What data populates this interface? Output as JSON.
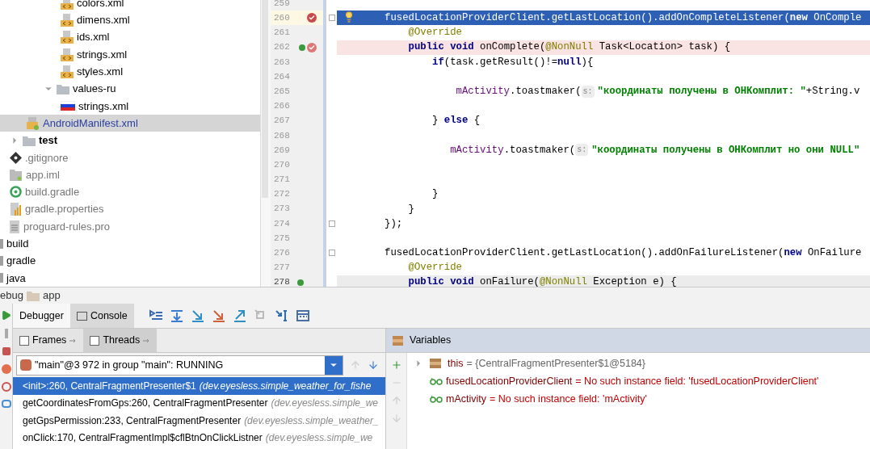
{
  "project_tree": [
    {
      "children": [
        {
          "children": [
            {
              "children": [
                {
                  "children": [
                    {
                      "label": "colors.xml",
                      "kind": "xml"
                    },
                    {
                      "label": "dimens.xml",
                      "kind": "xml"
                    },
                    {
                      "label": "ids.xml",
                      "kind": "xml"
                    },
                    {
                      "label": "strings.xml",
                      "kind": "xml"
                    },
                    {
                      "label": "styles.xml",
                      "kind": "xml"
                    }
                  ]
                },
                {
                  "label": "values-ru",
                  "kind": "folder",
                  "expanded": true,
                  "children": [
                    {
                      "label": "strings.xml",
                      "kind": "flag"
                    }
                  ]
                }
              ]
            },
            {
              "label": "AndroidManifest.xml",
              "kind": "manifest",
              "selected": true
            }
          ]
        },
        {
          "label": "test",
          "kind": "folder",
          "expanded": false,
          "bold": true
        },
        {
          "label": ".gitignore",
          "kind": "git"
        },
        {
          "label": "app.iml",
          "kind": "iml"
        },
        {
          "label": "build.gradle",
          "kind": "gradle"
        },
        {
          "label": "gradle.properties",
          "kind": "properties"
        },
        {
          "label": "proguard-rules.pro",
          "kind": "text"
        }
      ]
    },
    {
      "label": "build",
      "kind": "bar"
    },
    {
      "label": "gradle",
      "kind": "bar"
    },
    {
      "label": "java",
      "kind": "bar",
      "selected": false
    }
  ],
  "editor": {
    "lines": [
      {
        "number": "259",
        "selected": false,
        "breakpoint": false,
        "override": false,
        "caret": false
      },
      {
        "number": "260",
        "selected": true,
        "breakpoint": true,
        "override": false,
        "caret": false,
        "bulb": true,
        "fold": true,
        "segments": [
          {
            "text": "        fusedLocationProviderClient.getLastLocation().addOnCompleteListener(",
            "kind": "plain"
          },
          {
            "text": "new ",
            "kind": "keyword"
          },
          {
            "text": "OnComple",
            "kind": "plain"
          }
        ]
      },
      {
        "number": "261",
        "selected": false,
        "breakpoint": false,
        "override": false,
        "caret": false,
        "segments": [
          {
            "text": "            @Override",
            "kind": "annotation"
          }
        ]
      },
      {
        "number": "262",
        "selected": false,
        "breakpoint": true,
        "override": true,
        "caret": false,
        "segments": [
          {
            "text": "            public void ",
            "kind": "keyword"
          },
          {
            "text": "onComplete(",
            "kind": "plain"
          },
          {
            "text": "@NonNull",
            "kind": "annotation"
          },
          {
            "text": " Task<Location> task) {",
            "kind": "plain"
          }
        ]
      },
      {
        "number": "263",
        "selected": false,
        "breakpoint": false,
        "override": false,
        "caret": false,
        "segments": [
          {
            "text": "                if",
            "kind": "keyword"
          },
          {
            "text": "(task.getResult()!=",
            "kind": "plain"
          },
          {
            "text": "null",
            "kind": "keyword"
          },
          {
            "text": "){",
            "kind": "plain"
          }
        ]
      },
      {
        "number": "264",
        "selected": false,
        "breakpoint": false,
        "override": false,
        "caret": false
      },
      {
        "number": "265",
        "selected": false,
        "breakpoint": false,
        "override": false,
        "caret": false,
        "segments": [
          {
            "text": "                    mActivity",
            "kind": "field"
          },
          {
            "text": ".toastmaker(",
            "kind": "plain"
          },
          {
            "text": "s:",
            "kind": "hint"
          },
          {
            "text": "\"координаты получены в ОНКомплит: \"",
            "kind": "string"
          },
          {
            "text": "+String.v",
            "kind": "plain"
          }
        ]
      },
      {
        "number": "266",
        "selected": false,
        "breakpoint": false,
        "override": false,
        "caret": false
      },
      {
        "number": "267",
        "selected": false,
        "breakpoint": false,
        "override": false,
        "caret": false,
        "segments": [
          {
            "text": "                } ",
            "kind": "plain"
          },
          {
            "text": "else",
            "kind": "keyword"
          },
          {
            "text": " {",
            "kind": "plain"
          }
        ]
      },
      {
        "number": "268",
        "selected": false,
        "breakpoint": false,
        "override": false,
        "caret": false
      },
      {
        "number": "269",
        "selected": false,
        "breakpoint": false,
        "override": false,
        "caret": false,
        "segments": [
          {
            "text": "                   mActivity",
            "kind": "field"
          },
          {
            "text": ".toastmaker(",
            "kind": "plain"
          },
          {
            "text": "s:",
            "kind": "hint"
          },
          {
            "text": "\"координаты получены в ОНКомплит но они NULL\"",
            "kind": "string"
          }
        ]
      },
      {
        "number": "270",
        "selected": false,
        "breakpoint": false,
        "override": false,
        "caret": false
      },
      {
        "number": "271",
        "selected": false,
        "breakpoint": false,
        "override": false,
        "caret": false
      },
      {
        "number": "272",
        "selected": false,
        "breakpoint": false,
        "override": false,
        "caret": false,
        "segments": [
          {
            "text": "                }",
            "kind": "plain"
          }
        ]
      },
      {
        "number": "273",
        "selected": false,
        "breakpoint": false,
        "override": false,
        "caret": false,
        "segments": [
          {
            "text": "            }",
            "kind": "plain"
          }
        ]
      },
      {
        "number": "274",
        "selected": false,
        "breakpoint": false,
        "override": false,
        "caret": false,
        "fold": true,
        "segments": [
          {
            "text": "        });",
            "kind": "plain"
          }
        ]
      },
      {
        "number": "275",
        "selected": false,
        "breakpoint": false,
        "override": false,
        "caret": false
      },
      {
        "number": "276",
        "selected": false,
        "breakpoint": false,
        "override": false,
        "caret": false,
        "fold": true,
        "segments": [
          {
            "text": "        fusedLocationProviderClient.getLastLocation().addOnFailureListener(",
            "kind": "plain"
          },
          {
            "text": "new ",
            "kind": "keyword"
          },
          {
            "text": "OnFailure",
            "kind": "plain"
          }
        ]
      },
      {
        "number": "277",
        "selected": false,
        "breakpoint": false,
        "override": false,
        "caret": false,
        "segments": [
          {
            "text": "            @Override",
            "kind": "annotation"
          }
        ]
      },
      {
        "number": "278",
        "selected": false,
        "breakpoint": false,
        "override": true,
        "caret": true,
        "segments": [
          {
            "text": "            public void ",
            "kind": "keyword"
          },
          {
            "text": "onFailure(",
            "kind": "plain"
          },
          {
            "text": "@NonNull",
            "kind": "annotation"
          },
          {
            "text": " Exception e) {",
            "kind": "plain"
          }
        ]
      }
    ]
  },
  "debug_panel": {
    "title": "ebug",
    "config": "app",
    "tabs": [
      {
        "label": "Debugger",
        "selected": true
      },
      {
        "label": "Console",
        "selected": false
      }
    ],
    "frames_tabs": [
      {
        "label": "Frames",
        "selected": true
      },
      {
        "label": "Threads",
        "selected": false
      }
    ],
    "thread": "\"main\"@3 972 in group \"main\": RUNNING",
    "frames": [
      {
        "method": "<init>:260, CentralFragmentPresenter$1",
        "package": "(dev.eyesless.simple_weather_for_fishe",
        "selected": true
      },
      {
        "method": "getCoordinatesFromGps:260, CentralFragmentPresenter",
        "package": "(dev.eyesless.simple_we",
        "selected": false
      },
      {
        "method": "getGpsPermission:233, CentralFragmentPresenter",
        "package": "(dev.eyesless.simple_weather_",
        "selected": false
      },
      {
        "method": "onClick:170, CentralFragmentImpl$cflBtnOnClickListner",
        "package": "(dev.eyesless.simple_we",
        "selected": false
      }
    ],
    "variables_title": "Variables",
    "variables": [
      {
        "kind": "object",
        "name": "this",
        "value": "= {CentralFragmentPresenter$1@5184}",
        "expanded": false
      },
      {
        "kind": "watch-error",
        "name": "fusedLocationProviderClient",
        "value": "= No such instance field: 'fusedLocationProviderClient'"
      },
      {
        "kind": "watch-error",
        "name": "mActivity",
        "value": "= No such instance field: 'mActivity'"
      }
    ]
  }
}
